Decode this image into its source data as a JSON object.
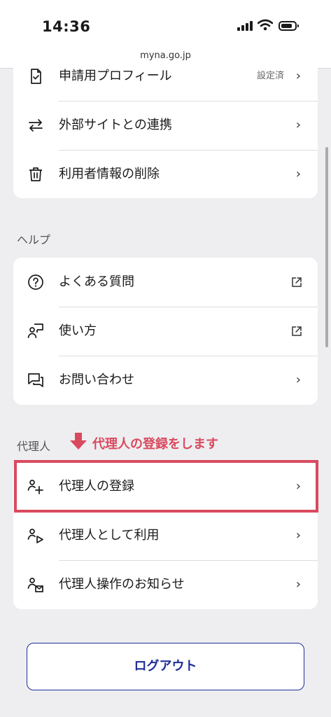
{
  "status_bar": {
    "time": "14:36"
  },
  "browser": {
    "url": "myna.go.jp"
  },
  "account_section": {
    "items": [
      {
        "label": "申請用プロフィール",
        "status": "設定済",
        "icon": "document-check-icon",
        "action": "chevron"
      },
      {
        "label": "外部サイトとの連携",
        "icon": "swap-arrows-icon",
        "action": "chevron"
      },
      {
        "label": "利用者情報の削除",
        "icon": "trash-icon",
        "action": "chevron"
      }
    ]
  },
  "help_section": {
    "title": "ヘルプ",
    "items": [
      {
        "label": "よくある質問",
        "icon": "question-circle-icon",
        "action": "external"
      },
      {
        "label": "使い方",
        "icon": "person-board-icon",
        "action": "external"
      },
      {
        "label": "お問い合わせ",
        "icon": "chat-bubbles-icon",
        "action": "chevron"
      }
    ]
  },
  "proxy_section": {
    "title": "代理人",
    "callout": "代理人の登録をします",
    "items": [
      {
        "label": "代理人の登録",
        "icon": "person-add-icon",
        "action": "chevron",
        "highlighted": true
      },
      {
        "label": "代理人として利用",
        "icon": "person-play-icon",
        "action": "chevron"
      },
      {
        "label": "代理人操作のお知らせ",
        "icon": "person-mail-icon",
        "action": "chevron"
      }
    ]
  },
  "chevron_glyph": "›",
  "logout_label": "ログアウト",
  "colors": {
    "accent": "#1e2f97",
    "highlight": "#d94a5e",
    "background": "#eeeef1"
  }
}
